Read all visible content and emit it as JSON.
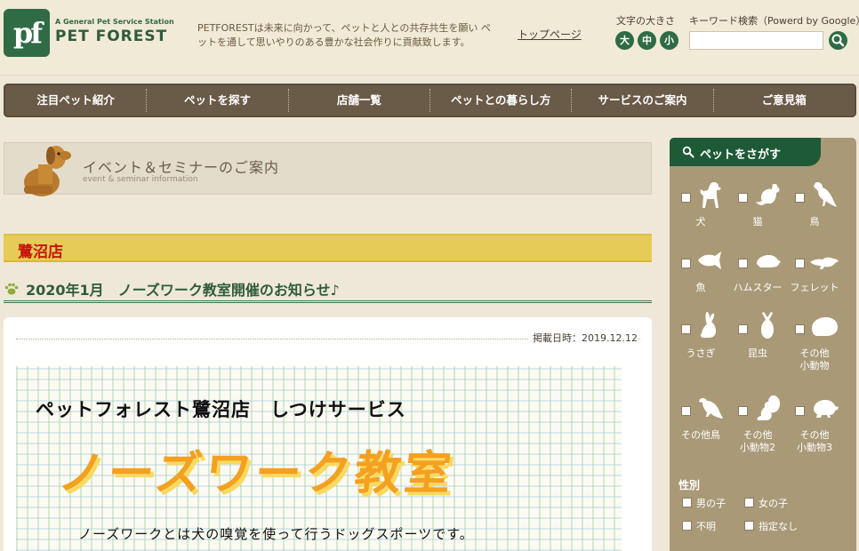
{
  "header": {
    "logo_mark": "pf",
    "logo_tagline": "A General Pet Service Station",
    "logo_name": "PET FOREST",
    "tagline": "PETFORESTは未来に向かって、ペットと人との共存共生を願い ペットを通して思いやりのある豊かな社会作りに貢献致します。",
    "top_page": "トップページ",
    "font_size_label": "文字の大きさ",
    "font_sizes": [
      "大",
      "中",
      "小"
    ],
    "search_label": "キーワード検索（Powerd by Google）",
    "search_value": ""
  },
  "nav": {
    "items": [
      "注目ペット紹介",
      "ペットを探す",
      "店舗一覧",
      "ペットとの暮らし方",
      "サービスのご案内",
      "ご意見箱"
    ]
  },
  "banner": {
    "title": "イベント＆セミナーのご案内",
    "subtitle": "event & seminar information"
  },
  "store": {
    "name": "鷺沼店"
  },
  "article": {
    "heading": "2020年1月　ノーズワーク教室開催のお知らせ♪",
    "date": "掲載日時：2019.12.12",
    "flyer_line1": "ペットフォレスト鷺沼店　しつけサービス",
    "flyer_line2": "ノーズワーク教室",
    "flyer_line3": "ノーズワークとは犬の嗅覚を使って行うドッグスポーツです。"
  },
  "sidebar": {
    "title": "ペットをさがす",
    "pets": [
      {
        "label": "犬",
        "icon": "dog-icon"
      },
      {
        "label": "猫",
        "icon": "cat-icon"
      },
      {
        "label": "鳥",
        "icon": "bird-icon"
      },
      {
        "label": "魚",
        "icon": "fish-icon"
      },
      {
        "label": "ハムスター",
        "icon": "hamster-icon"
      },
      {
        "label": "フェレット",
        "icon": "ferret-icon"
      },
      {
        "label": "うさぎ",
        "icon": "rabbit-icon"
      },
      {
        "label": "昆虫",
        "icon": "beetle-icon"
      },
      {
        "label": "その他\n小動物",
        "icon": "small-animal-icon"
      },
      {
        "label": "その他鳥",
        "icon": "other-bird-icon"
      },
      {
        "label": "その他\n小動物2",
        "icon": "squirrel-icon"
      },
      {
        "label": "その他\n小動物3",
        "icon": "turtle-icon"
      }
    ],
    "gender_title": "性別",
    "gender_options": [
      "男の子",
      "女の子",
      "不明",
      "指定なし"
    ]
  },
  "colors": {
    "brand_green": "#2f6b45",
    "nav_brown": "#6a5a48",
    "store_yellow": "#e6cb56",
    "store_red": "#c4160f",
    "flyer_orange": "#f4a020"
  }
}
